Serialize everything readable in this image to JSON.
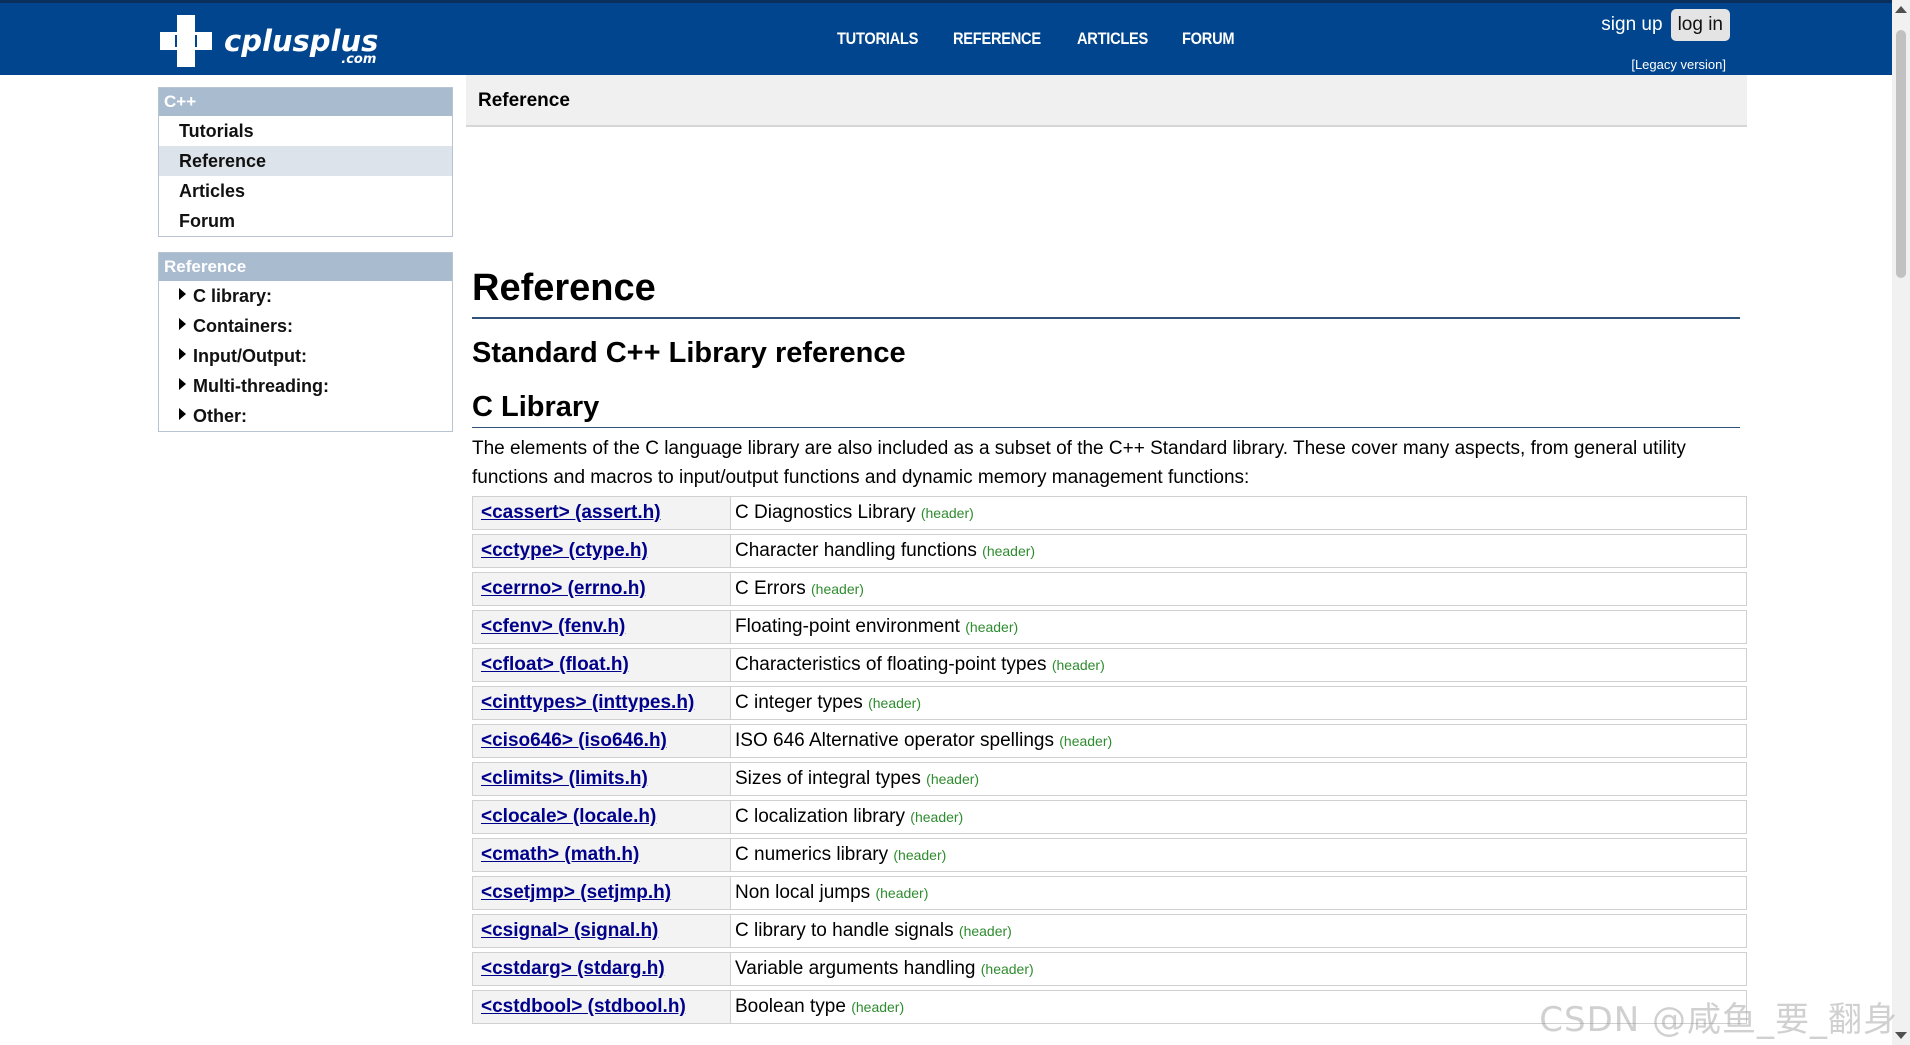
{
  "header": {
    "logo_text": "cplusplus",
    "logo_sub": ".com",
    "nav": [
      "TUTORIALS",
      "REFERENCE",
      "ARTICLES",
      "FORUM"
    ],
    "signup": "sign up",
    "login": "log in",
    "legacy": "[Legacy version]",
    "bg_color": "#00458d"
  },
  "sidebar": {
    "cpp_box": {
      "title": "C++",
      "items": [
        "Tutorials",
        "Reference",
        "Articles",
        "Forum"
      ],
      "active": "Reference"
    },
    "ref_box": {
      "title": "Reference",
      "items": [
        "C library:",
        "Containers:",
        "Input/Output:",
        "Multi-threading:",
        "Other:"
      ]
    }
  },
  "breadcrumb": "Reference",
  "main": {
    "title": "Reference",
    "subtitle": "Standard C++ Library reference",
    "section": "C Library",
    "intro": "The elements of the C language library are also included as a subset of the C++ Standard library. These cover many aspects, from general utility functions and macros to input/output functions and dynamic memory management functions:",
    "tag": "(header)",
    "rows": [
      {
        "name": "<cassert> (assert.h)",
        "desc": "C Diagnostics Library"
      },
      {
        "name": "<cctype> (ctype.h)",
        "desc": "Character handling functions"
      },
      {
        "name": "<cerrno> (errno.h)",
        "desc": "C Errors"
      },
      {
        "name": "<cfenv> (fenv.h)",
        "desc": "Floating-point environment"
      },
      {
        "name": "<cfloat> (float.h)",
        "desc": "Characteristics of floating-point types"
      },
      {
        "name": "<cinttypes> (inttypes.h)",
        "desc": "C integer types"
      },
      {
        "name": "<ciso646> (iso646.h)",
        "desc": "ISO 646 Alternative operator spellings"
      },
      {
        "name": "<climits> (limits.h)",
        "desc": "Sizes of integral types"
      },
      {
        "name": "<clocale> (locale.h)",
        "desc": "C localization library"
      },
      {
        "name": "<cmath> (math.h)",
        "desc": "C numerics library"
      },
      {
        "name": "<csetjmp> (setjmp.h)",
        "desc": "Non local jumps"
      },
      {
        "name": "<csignal> (signal.h)",
        "desc": "C library to handle signals"
      },
      {
        "name": "<cstdarg> (stdarg.h)",
        "desc": "Variable arguments handling"
      },
      {
        "name": "<cstdbool> (stdbool.h)",
        "desc": "Boolean type"
      }
    ]
  },
  "watermark": "CSDN @咸鱼_要_翻身"
}
